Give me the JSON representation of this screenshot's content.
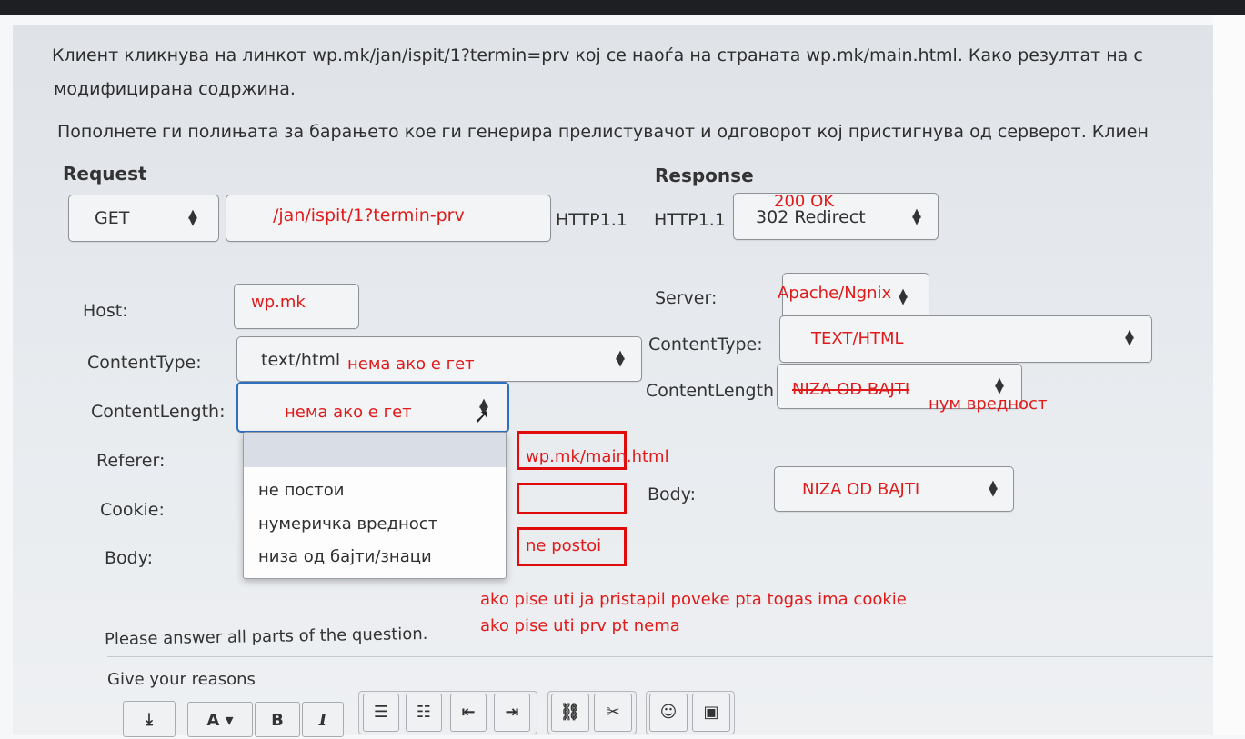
{
  "question": {
    "line1": "Клиент кликнува на линкот  wp.mk/jan/ispit/1?termin=prv кој се наоѓа на страната wp.mk/main.html. Како резултат на с",
    "line2": "модифицирана содржина.",
    "line3": "Пополнете ги полињата за барањето кое ги генерира прелистувачот и одговорот кој пристигнува од серверот. Клиен"
  },
  "request": {
    "heading": "Request",
    "method": "GET",
    "path": "/jan/ispit/1?termin-prv",
    "version": "HTTP1.1",
    "host_label": "Host:",
    "host_value": "wp.mk",
    "content_type_label": "ContentType:",
    "content_type_value": "text/html",
    "content_type_note": "нема ако е гет",
    "content_length_label": "ContentLength:",
    "content_length_value": "нема ако е гет",
    "referer_label": "Referer:",
    "cookie_label": "Cookie:",
    "body_label": "Body:",
    "dropdown_options": [
      "",
      "не постои",
      "нумеричка вредност",
      "низа од бајти/знаци"
    ]
  },
  "response": {
    "heading": "Response",
    "version": "HTTP1.1",
    "status": "302 Redirect",
    "status_note": "200 OK",
    "server_label": "Server:",
    "server_value": "Apache/Ngnix",
    "content_type_label": "ContentType:",
    "content_type_value": "TEXT/HTML",
    "content_length_label": "ContentLength",
    "content_length_struck": "NIZA OD BAJTI",
    "content_length_note": "нум вредност",
    "body_label": "Body:",
    "body_value": "NIZA OD BAJTI"
  },
  "annotations": {
    "referer": "wp.mk/main.html",
    "body": "ne postoi",
    "note_line1": "ako pise uti ja pristapil poveke pta togas ima cookie",
    "note_line2": "ako pise uti prv pt nema"
  },
  "footer": {
    "instruction": "Please answer all parts of the question.",
    "reasons": "Give your reasons"
  },
  "toolbar": {
    "font_label": "A",
    "bold_label": "B",
    "italic_label": "I"
  },
  "colors": {
    "annotation_red": "#e01a1a",
    "focus_blue": "#2f6fc0"
  }
}
